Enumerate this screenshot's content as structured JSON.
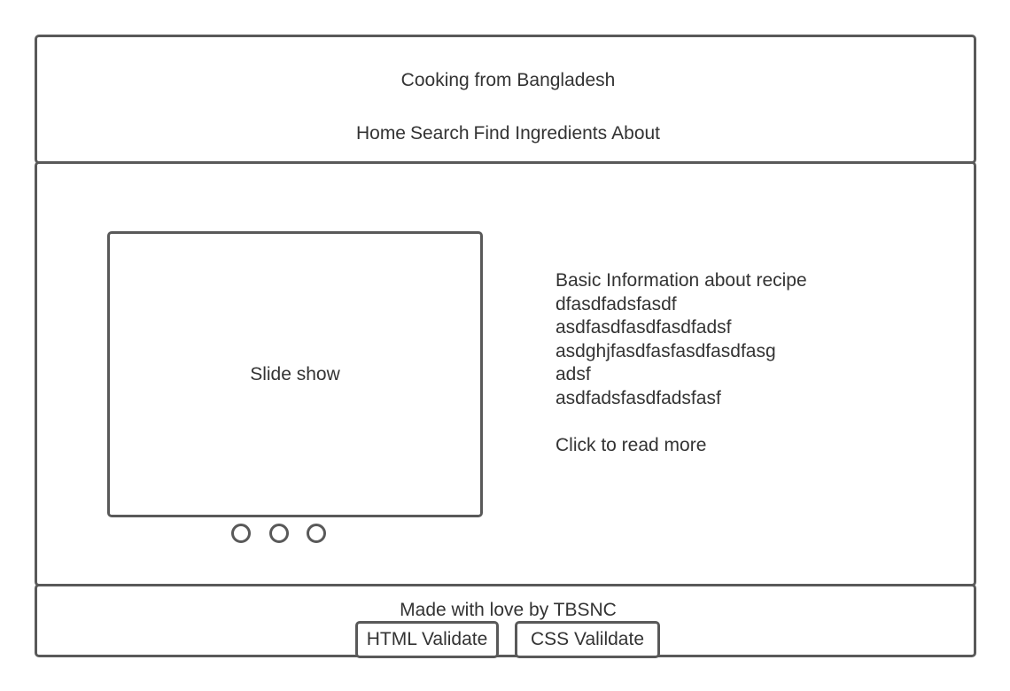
{
  "header": {
    "title": "Cooking from Bangladesh",
    "nav": [
      "Home",
      "Search",
      "Find Ingredients",
      "About"
    ]
  },
  "main": {
    "slideshow_label": "Slide show",
    "info_lines": [
      "Basic Information about recipe",
      "dfasdfadsfasdf",
      "asdfasdfasdfasdfadsf",
      "asdghjfasdfasfasdfasdfasg",
      "adsf",
      "asdfadsfasdfadsfasf"
    ],
    "read_more": "Click to read more"
  },
  "footer": {
    "credit": "Made with love by TBSNC",
    "html_validate": "HTML Validate",
    "css_validate": "CSS Valildate"
  }
}
